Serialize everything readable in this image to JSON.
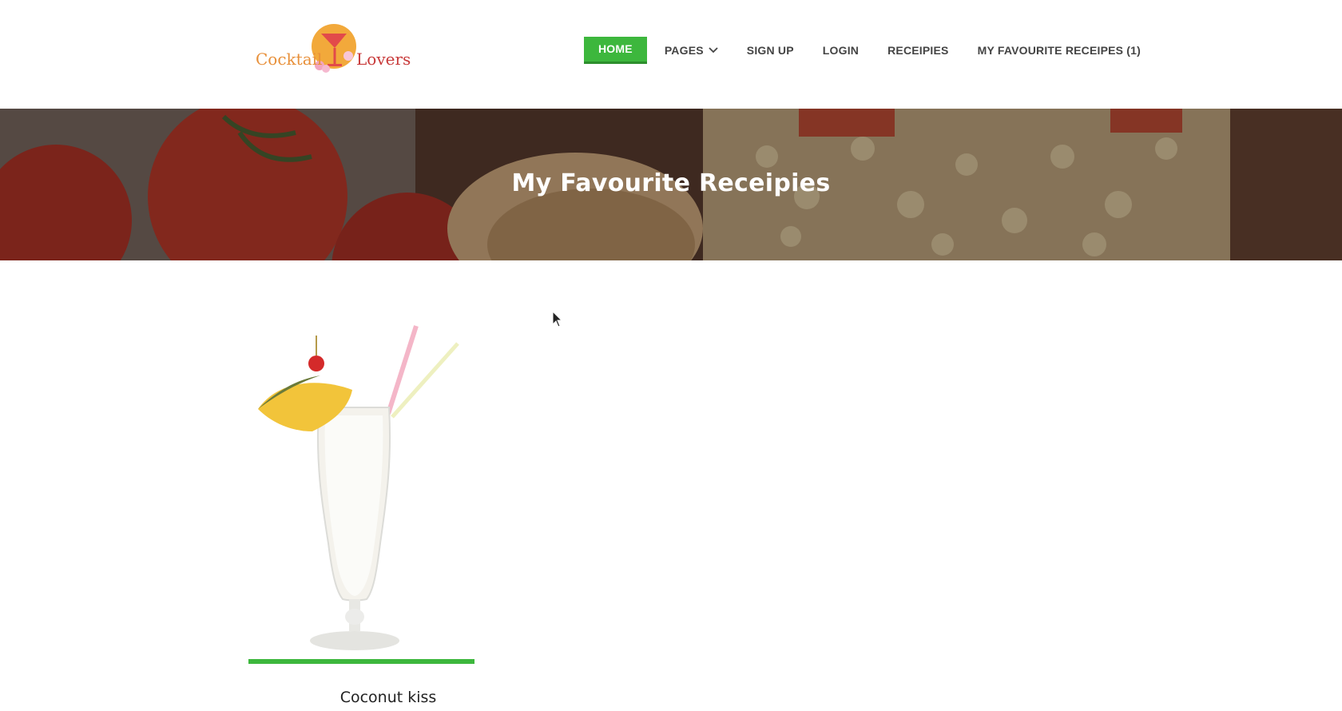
{
  "brand": {
    "logo_word_1": "Cocktail",
    "logo_word_2": "Lovers",
    "accent_color": "#3db73d"
  },
  "nav": {
    "items": [
      {
        "label": "HOME",
        "active": true
      },
      {
        "label": "PAGES",
        "icon": "chevron-down-icon"
      },
      {
        "label": "SIGN UP"
      },
      {
        "label": "LOGIN"
      },
      {
        "label": "RECEIPIES"
      },
      {
        "label": "MY FAVOURITE RECEIPES (1)"
      }
    ]
  },
  "banner": {
    "title": "My Favourite Receipies"
  },
  "favourites": [
    {
      "title": "Coconut kiss",
      "image": "cocktail-glass-image"
    }
  ]
}
